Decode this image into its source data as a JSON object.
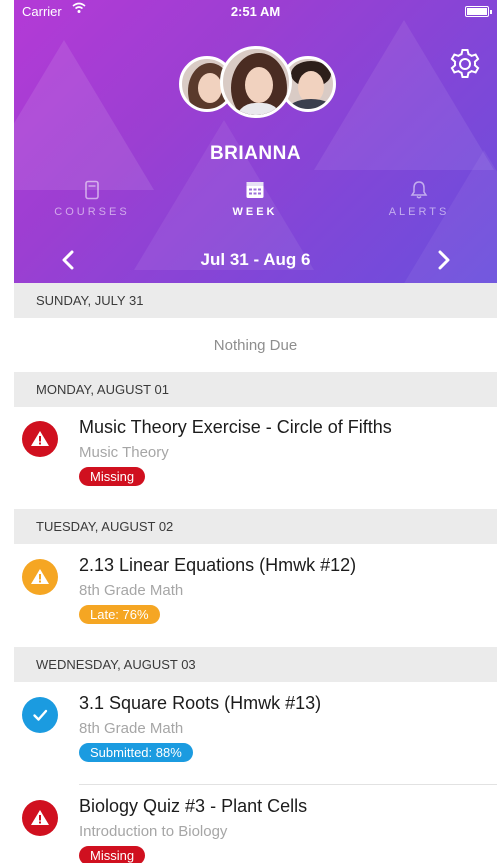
{
  "status_bar": {
    "carrier": "Carrier",
    "time": "2:51 AM"
  },
  "profile": {
    "name": "BRIANNA"
  },
  "tabs": [
    {
      "label": "COURSES",
      "icon": "book-icon"
    },
    {
      "label": "WEEK",
      "icon": "calendar-icon"
    },
    {
      "label": "ALERTS",
      "icon": "bell-icon"
    }
  ],
  "week": {
    "range": "Jul 31 - Aug 6"
  },
  "days": [
    {
      "header": "SUNDAY, JULY 31",
      "empty_text": "Nothing Due"
    },
    {
      "header": "MONDAY, AUGUST 01"
    },
    {
      "header": "TUESDAY, AUGUST 02"
    },
    {
      "header": "WEDNESDAY, AUGUST 03"
    }
  ],
  "assignments": [
    {
      "title": "Music Theory Exercise - Circle of Fifths",
      "course": "Music Theory",
      "badge": "Missing",
      "status": "missing",
      "icon": "alert-icon"
    },
    {
      "title": "2.13 Linear Equations (Hmwk #12)",
      "course": "8th Grade Math",
      "badge": "Late: 76%",
      "status": "late",
      "icon": "alert-icon"
    },
    {
      "title": "3.1 Square Roots (Hmwk #13)",
      "course": "8th Grade Math",
      "badge": "Submitted: 88%",
      "status": "submitted",
      "icon": "checkmark-icon"
    },
    {
      "title": "Biology Quiz #3 - Plant Cells",
      "course": "Introduction to Biology",
      "badge": "Missing",
      "status": "missing",
      "icon": "alert-icon"
    }
  ],
  "colors": {
    "missing": "#d0101f",
    "late": "#f5a623",
    "submitted": "#1b9be0",
    "header_gradient_start": "#b43ad6",
    "header_gradient_end": "#6a4fdc"
  }
}
